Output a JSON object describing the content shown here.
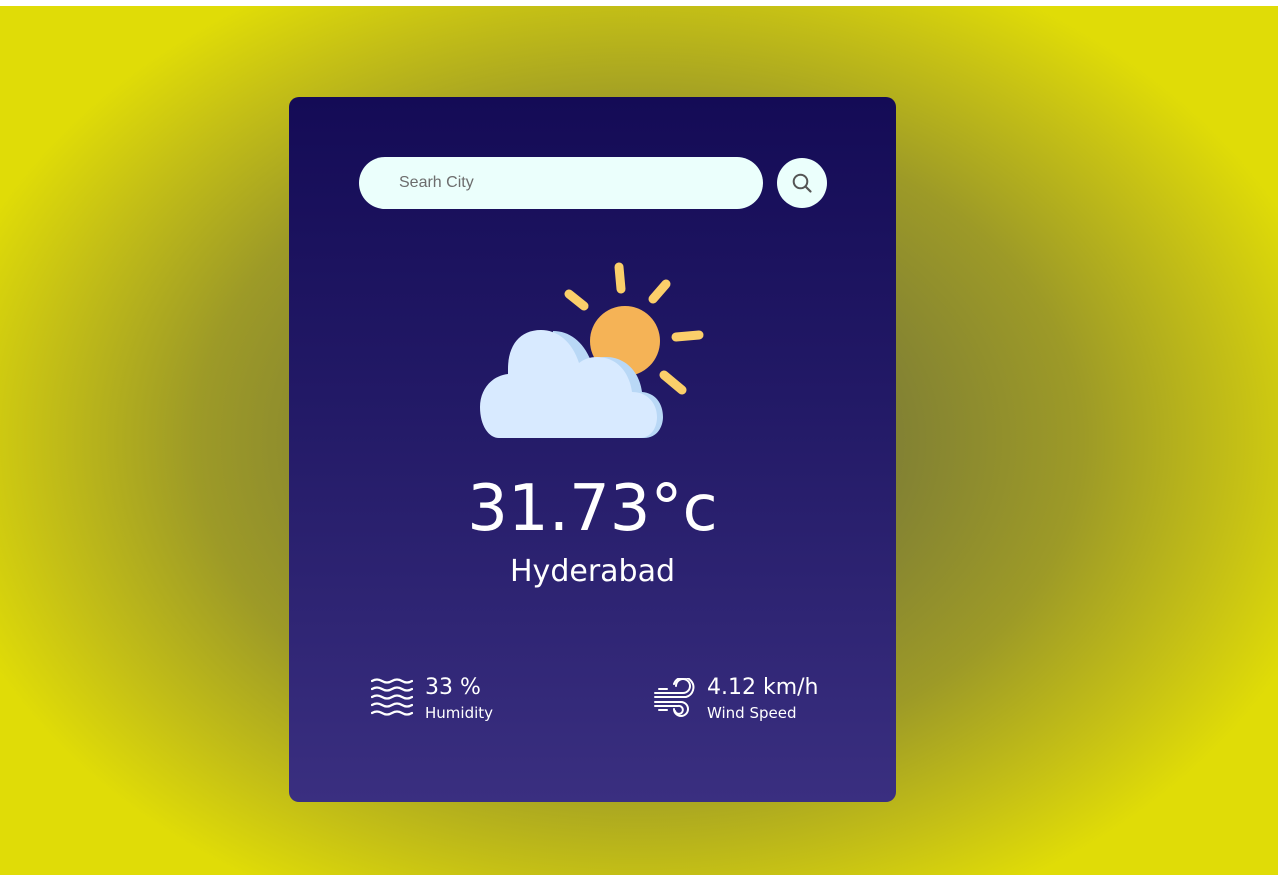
{
  "search": {
    "placeholder": "Searh City",
    "value": "",
    "button_icon": "search-icon"
  },
  "weather": {
    "icon": "partly-cloudy-icon",
    "temperature": "31.73°c",
    "city": "Hyderabad"
  },
  "details": {
    "humidity": {
      "icon": "waves-icon",
      "value": "33 %",
      "label": "Humidity"
    },
    "wind": {
      "icon": "wind-icon",
      "value": "4.12 km/h",
      "label": "Wind Speed"
    }
  },
  "colors": {
    "card_top": "#140b56",
    "card_bottom": "#3a2f80",
    "input_bg": "#ebfffc",
    "sun": "#f5b356",
    "sun_rays": "#fbcf6a",
    "cloud": "#d8eaff",
    "cloud_shade": "#b9d8f6",
    "background_accent": "#e0dc07"
  }
}
